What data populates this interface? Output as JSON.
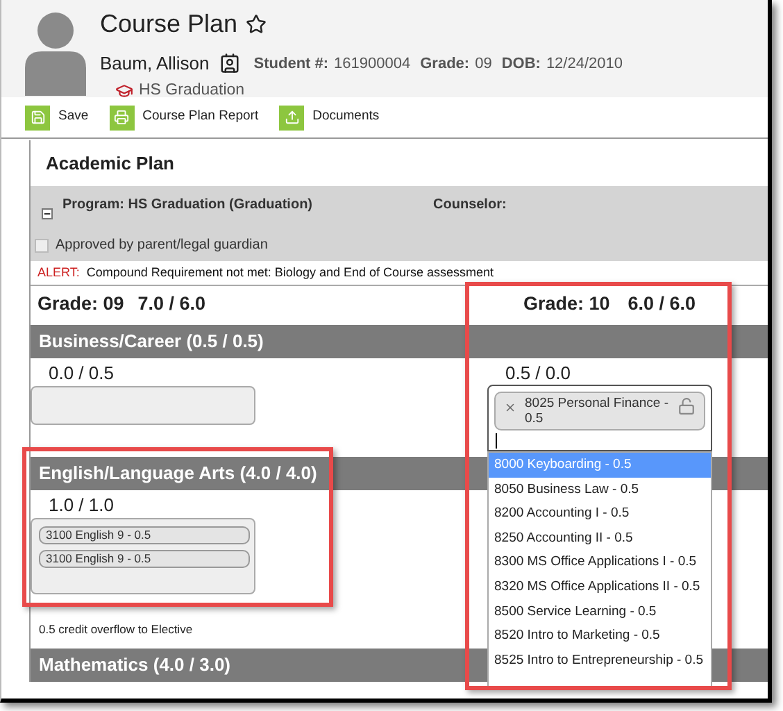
{
  "header": {
    "title": "Course Plan",
    "student_name": "Baum, Allison",
    "student_number_label": "Student #:",
    "student_number": "161900004",
    "grade_label": "Grade:",
    "grade": "09",
    "dob_label": "DOB:",
    "dob": "12/24/2010",
    "program": "HS Graduation"
  },
  "toolbar": [
    {
      "kind": "save",
      "label": "Save"
    },
    {
      "kind": "print",
      "label": "Course Plan Report"
    },
    {
      "kind": "upload",
      "label": "Documents"
    }
  ],
  "plan": {
    "title": "Academic Plan",
    "program": "Program: HS Graduation (Graduation)",
    "counselor": "Counselor:",
    "expanded": true,
    "approval": {
      "label": "Approved by parent/legal guardian",
      "checked": false
    },
    "alert": {
      "label": "ALERT:",
      "text": "Compound Requirement not met: Biology and End of Course assessment"
    }
  },
  "grades": [
    {
      "grade": "Grade: 09",
      "credits": "7.0 / 6.0"
    },
    {
      "grade": "Grade: 10",
      "credits": "6.0 / 6.0"
    }
  ],
  "categories": [
    {
      "name": "Business/Career (0.5 / 0.5)",
      "cells": [
        {
          "credits": "0.0 / 0.5"
        },
        {
          "credits": "0.5 / 0.0",
          "editing": true,
          "courses": [
            {
              "label": "8025 Personal Finance - 0.5",
              "locked": false
            }
          ],
          "dropdown": {
            "options": [
              {
                "label": "8000 Keyboarding - 0.5",
                "selected": true
              },
              {
                "label": "8050 Business Law - 0.5",
                "selected": false
              },
              {
                "label": "8200 Accounting I - 0.5",
                "selected": false
              },
              {
                "label": "8250 Accounting II - 0.5",
                "selected": false
              },
              {
                "label": "8300 MS Office Applications I - 0.5",
                "selected": false
              },
              {
                "label": "8320 MS Office Applications II - 0.5",
                "selected": false
              },
              {
                "label": "8500 Service Learning - 0.5",
                "selected": false
              },
              {
                "label": "8520 Intro to Marketing - 0.5",
                "selected": false
              },
              {
                "label": "8525 Intro to Entrepreneurship - 0.5",
                "selected": false
              }
            ]
          }
        }
      ]
    },
    {
      "name": "English/Language Arts (4.0 / 4.0)",
      "cells": [
        {
          "credits": "1.0 / 1.0",
          "courses": [
            {
              "label": "3100 English 9 - 0.5"
            },
            {
              "label": "3100 English 9 - 0.5"
            }
          ],
          "note": "0.5 credit overflow to Elective"
        }
      ]
    },
    {
      "name": "Mathematics (4.0 / 3.0)"
    }
  ]
}
